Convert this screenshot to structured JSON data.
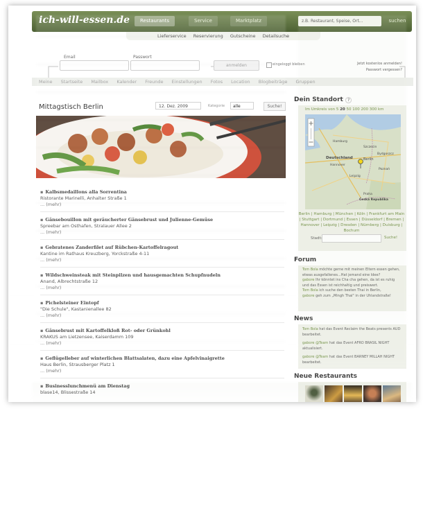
{
  "header": {
    "logo": "ich-will-essen.de",
    "tabs": [
      "Restaurants",
      "Service",
      "Marktplatz"
    ],
    "search_placeholder": "z.B. Restaurant, Speise, Ort...",
    "search_button": "suchen"
  },
  "subnav": [
    "Lieferservice",
    "Reservierung",
    "Gutscheine",
    "Detailsuche"
  ],
  "login": {
    "email_label": "Email",
    "password_label": "Passwort",
    "button": "anmelden",
    "remember": "eingeloggt bleiben",
    "register": "Jetzt kostenlos anmelden!",
    "forgot": "Passwort vergessen?"
  },
  "menu": [
    "Meine",
    "Startseite",
    "Mailbox",
    "Kalender",
    "Freunde",
    "Einstellungen",
    "Fotos",
    "Location",
    "Blogbeiträge",
    "Gruppen"
  ],
  "main": {
    "title": "Mittagstisch Berlin",
    "date": "12. Dez. 2009",
    "category_label": "Kategorie",
    "category_value": "alle",
    "search_button": "Suche!",
    "items": [
      {
        "title": "Kalbsmedaillons alla Sorrentina",
        "place": "Ristorante Marinelli, Anhalter Straße 1",
        "more": "... (mehr)"
      },
      {
        "title": "Gänsebouillon mit geräucherter Gänsebrust und Julienne-Gemüse",
        "place": "Spreebar am Osthafen, Stralauer Allee 2",
        "more": "... (mehr)"
      },
      {
        "title": "Gebratenes Zanderfilet auf Rübchen-Kartoffelragout",
        "place": "Kantine im Rathaus Kreuzberg, Yorckstraße 4-11",
        "more": "... (mehr)"
      },
      {
        "title": "Wildschweinsteak mit Steinpilzen und hausgemachten Schupfnudeln",
        "place": "Anand, Albrechtstraße 12",
        "more": "... (mehr)"
      },
      {
        "title": "Pichelsteiner Eintopf",
        "place": "\"Die Schule\", Kastanienallee 82",
        "more": "... (mehr)"
      },
      {
        "title": "Gänsebrust mit Kartoffelkloß Rot- oder Grünkohl",
        "place": "KRAKUS am Lietzensee, Kaiserdamm 109",
        "more": "... (mehr)"
      },
      {
        "title": "Geflügelleber auf winterlichen Blattsalaten, dazu eine Apfelvinaigrette",
        "place": "Haus Berlin, Strausberger Platz 1",
        "more": "... (mehr)"
      },
      {
        "title": "Businesslunchmenü am Dienstag",
        "place": "blase14, Blissestraße 14",
        "more": ""
      }
    ]
  },
  "sidebar": {
    "standort": {
      "title": "Dein Standort",
      "help": "?",
      "radius_label": "Im Umkreis von",
      "radius_options": [
        "5",
        "20",
        "50",
        "100",
        "200",
        "300",
        "km"
      ],
      "map_labels": [
        "Deutschland",
        "Berlin",
        "Hamburg",
        "Poznań",
        "Szczecin",
        "Bydgoszcz",
        "Hannover",
        "Leipzig",
        "Česká Republika",
        "Praha"
      ],
      "cities": "Berlin | Hamburg | München | Köln | Frankfurt am Main | Stuttgart | Dortmund | Essen | Düsseldorf | Bremen | Hannover | Leipzig | Dresden | Nürnberg | Duisburg | Bochum",
      "city_label": "Stadt:",
      "city_button": "Suche!"
    },
    "forum": {
      "title": "Forum",
      "posts": [
        {
          "user": "Tom Bola",
          "text": "möchte gerne mit meinen Eltern essen gehen, etwas ausgefallenes...Hat jemand eine Idee?"
        },
        {
          "user": "gabore",
          "text": "Ihr könntet ins Cha cha gehen, da ist es ruhig und das Essen ist reichhaltig und preiswert."
        },
        {
          "user": "Tom Bola",
          "text": "ich suche den besten Thai in Berlin,"
        },
        {
          "user": "gabore",
          "text": "geh zum „Mingh Thai\" in der Uhlandstraße!"
        }
      ]
    },
    "news": {
      "title": "News",
      "items": [
        {
          "user": "Tom Bola",
          "text": "hat das Event Reclaim the Beats presents AUD bearbeitet."
        },
        {
          "user": "gabore @Team",
          "text": "hat das Event AFRO BRASIL NIGHT aktualisiert."
        },
        {
          "user": "gabore @Team",
          "text": "hat das Event BARNEY MILLAH NIGHT bearbeitet."
        }
      ]
    },
    "new_restaurants": {
      "title": "Neue Restaurants"
    }
  },
  "colors": {
    "nav_green": "#5d7140",
    "link_green": "#6a8a3a",
    "panel_bg": "#eef0e8"
  }
}
